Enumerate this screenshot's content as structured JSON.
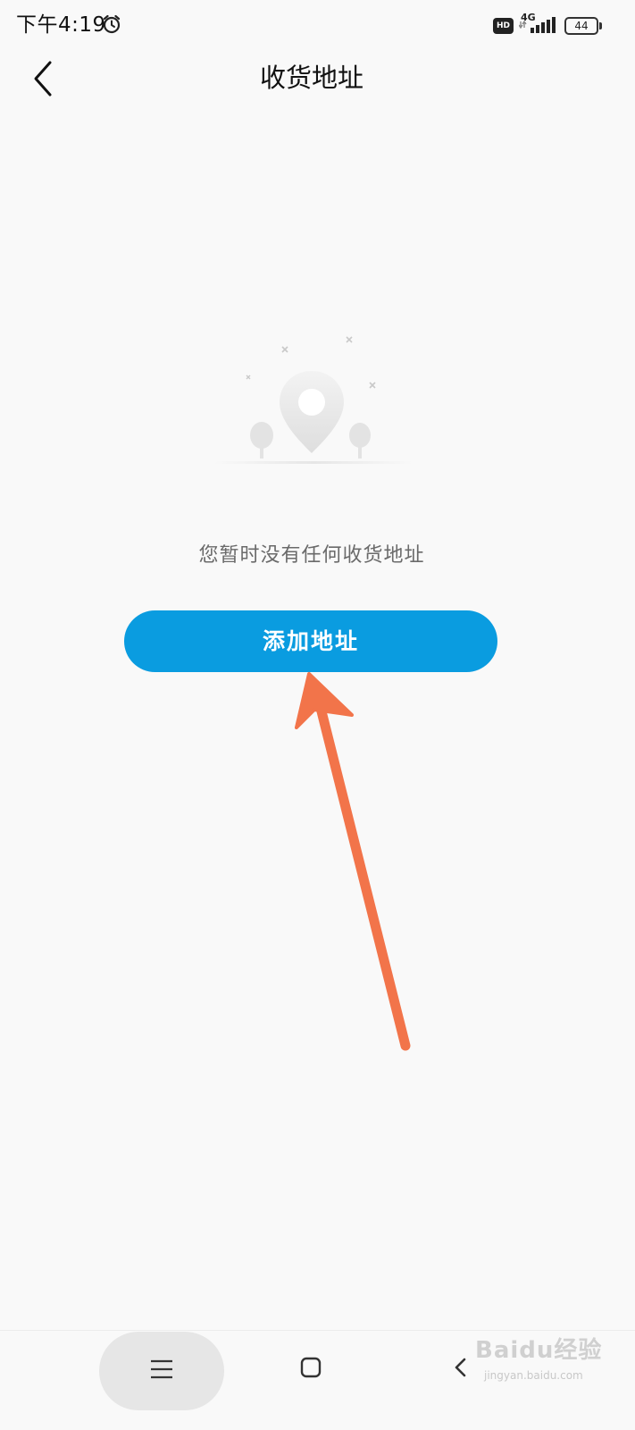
{
  "status_bar": {
    "time": "下午4:19",
    "hd_badge": "HD",
    "network": "4G",
    "battery": "44"
  },
  "header": {
    "title": "收货地址",
    "back_icon": "chevron-left-icon"
  },
  "empty_state": {
    "illustration_icon": "map-pin-icon",
    "message": "您暂时没有任何收货地址",
    "add_button_label": "添加地址"
  },
  "bottom_nav": {
    "menu_icon": "menu-icon",
    "home_icon": "square-icon",
    "back_icon": "chevron-left-icon"
  },
  "watermark": {
    "brand": "Baidu经验",
    "url": "jingyan.baidu.com"
  },
  "colors": {
    "background": "#f9f9f9",
    "accent": "#0a9ce0",
    "annotation_arrow": "#f2744a",
    "muted_text": "#6a6a6a"
  }
}
